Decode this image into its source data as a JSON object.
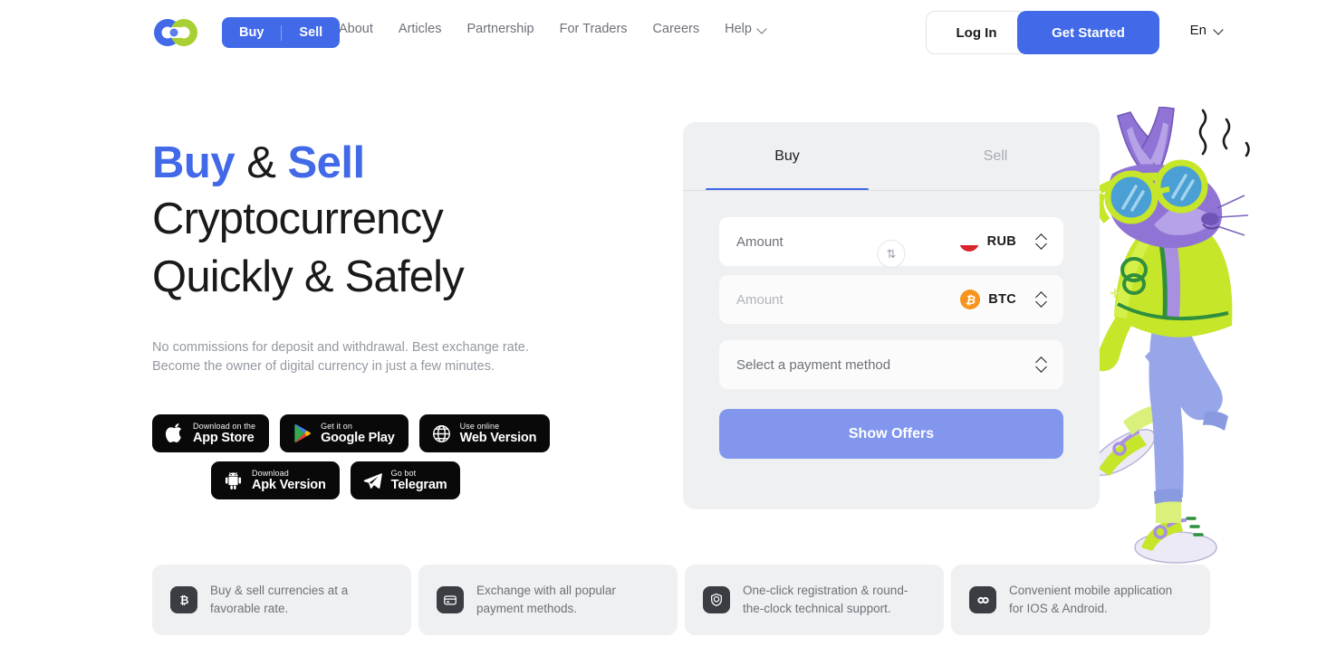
{
  "header": {
    "logo_name": "infinity-rings-logo",
    "logo_colors": {
      "left": "#4169e8",
      "right": "#a8d033"
    },
    "pill": {
      "buy_label": "Buy",
      "sell_label": "Sell",
      "bg": "#4169e8"
    },
    "nav_links": [
      {
        "label": "About",
        "has_chevron": false
      },
      {
        "label": "Articles",
        "has_chevron": false
      },
      {
        "label": "Partnership",
        "has_chevron": false
      },
      {
        "label": "For Traders",
        "has_chevron": false
      },
      {
        "label": "Careers",
        "has_chevron": false
      },
      {
        "label": "Help",
        "has_chevron": true
      }
    ],
    "login_label": "Log In",
    "get_started_label": "Get Started",
    "language": "En"
  },
  "hero": {
    "title_line1_a": "Buy",
    "title_line1_amp": " & ",
    "title_line1_b": "Sell",
    "title_line2": "Cryptocurrency",
    "title_line3": "Quickly & Safely",
    "subtitle_line1": "No commissions for deposit and withdrawal. Best exchange rate.",
    "subtitle_line2": "Become the owner of digital currency in just a few minutes.",
    "accent_color": "#4169e8",
    "store_buttons": [
      {
        "icon": "apple-icon",
        "small": "Download on the",
        "big": "App Store"
      },
      {
        "icon": "google-play-icon",
        "small": "Get it on",
        "big": "Google Play"
      },
      {
        "icon": "globe-icon",
        "small": "Use online",
        "big": "Web Version"
      },
      {
        "icon": "android-icon",
        "small": "Download",
        "big": "Apk Version"
      },
      {
        "icon": "telegram-icon",
        "small": "Go bot",
        "big": "Telegram"
      }
    ]
  },
  "widget": {
    "tabs": [
      {
        "label": "Buy",
        "active": true
      },
      {
        "label": "Sell",
        "active": false
      }
    ],
    "amount_from": {
      "placeholder": "Amount",
      "value": "",
      "currency": "RUB",
      "icon": "russia-flag-icon"
    },
    "amount_to": {
      "placeholder": "Amount",
      "value": "",
      "currency": "BTC",
      "icon": "bitcoin-icon"
    },
    "swap_icon": "swap-vertical-icon",
    "swap_glyph": "⇅",
    "payment_method_placeholder": "Select a payment method",
    "submit_label": "Show Offers",
    "submit_color": "#8296ee",
    "active_tab_underline_color": "#4169e8"
  },
  "mascot": {
    "name": "cat-mascot-illustration",
    "colors": {
      "fur": "#8f74d6",
      "jacket": "#c6e62a",
      "pants": "#97a6e8",
      "goggles": "#4a9fd4",
      "shoes": "#eceaf6"
    }
  },
  "features": [
    {
      "icon": "bitcoin-badge-icon",
      "glyph": "₿",
      "text_line1": "Buy & sell currencies at a",
      "text_line2": "favorable rate."
    },
    {
      "icon": "credit-card-icon",
      "glyph": "▤",
      "text_line1": "Exchange with all popular",
      "text_line2": "payment methods."
    },
    {
      "icon": "shield-check-icon",
      "glyph": "⛉",
      "text_line1": "One-click registration & round-",
      "text_line2": "the-clock technical support."
    },
    {
      "icon": "app-link-icon",
      "glyph": "∞",
      "text_line1": "Convenient mobile application",
      "text_line2": "for IOS & Android."
    }
  ]
}
